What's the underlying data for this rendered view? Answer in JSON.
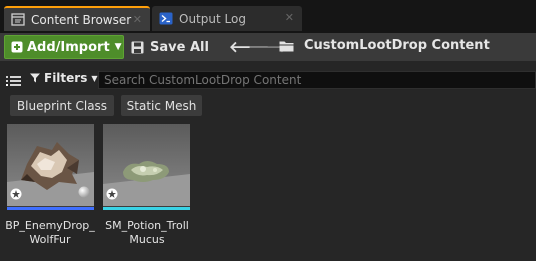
{
  "tabs": [
    {
      "label": "Content Browser",
      "icon": "content-browser-icon",
      "active": true
    },
    {
      "label": "Output Log",
      "icon": "output-log-icon",
      "active": false
    }
  ],
  "toolbar": {
    "add_import_label": "Add/Import",
    "save_all_label": "Save All",
    "current_folder": "CustomLootDrop Content"
  },
  "filter_bar": {
    "filters_label": "Filters",
    "search_placeholder": "Search CustomLootDrop Content"
  },
  "filter_chips": [
    "Blueprint Class",
    "Static Mesh"
  ],
  "assets": [
    {
      "name": "BP_EnemyDrop_WolfFur",
      "name_line1": "BP_EnemyDrop_",
      "name_line2": "WolfFur",
      "type": "Blueprint Class",
      "type_color": "#3f6fff"
    },
    {
      "name": "SM_Potion_TrollMucus",
      "name_line1": "SM_Potion_Troll",
      "name_line2": "Mucus",
      "type": "Static Mesh",
      "type_color": "#3ad3e6"
    }
  ],
  "colors": {
    "add_button": "#4e8d2a",
    "active_tab_accent": "#ff9f0a",
    "background": "#262626"
  }
}
